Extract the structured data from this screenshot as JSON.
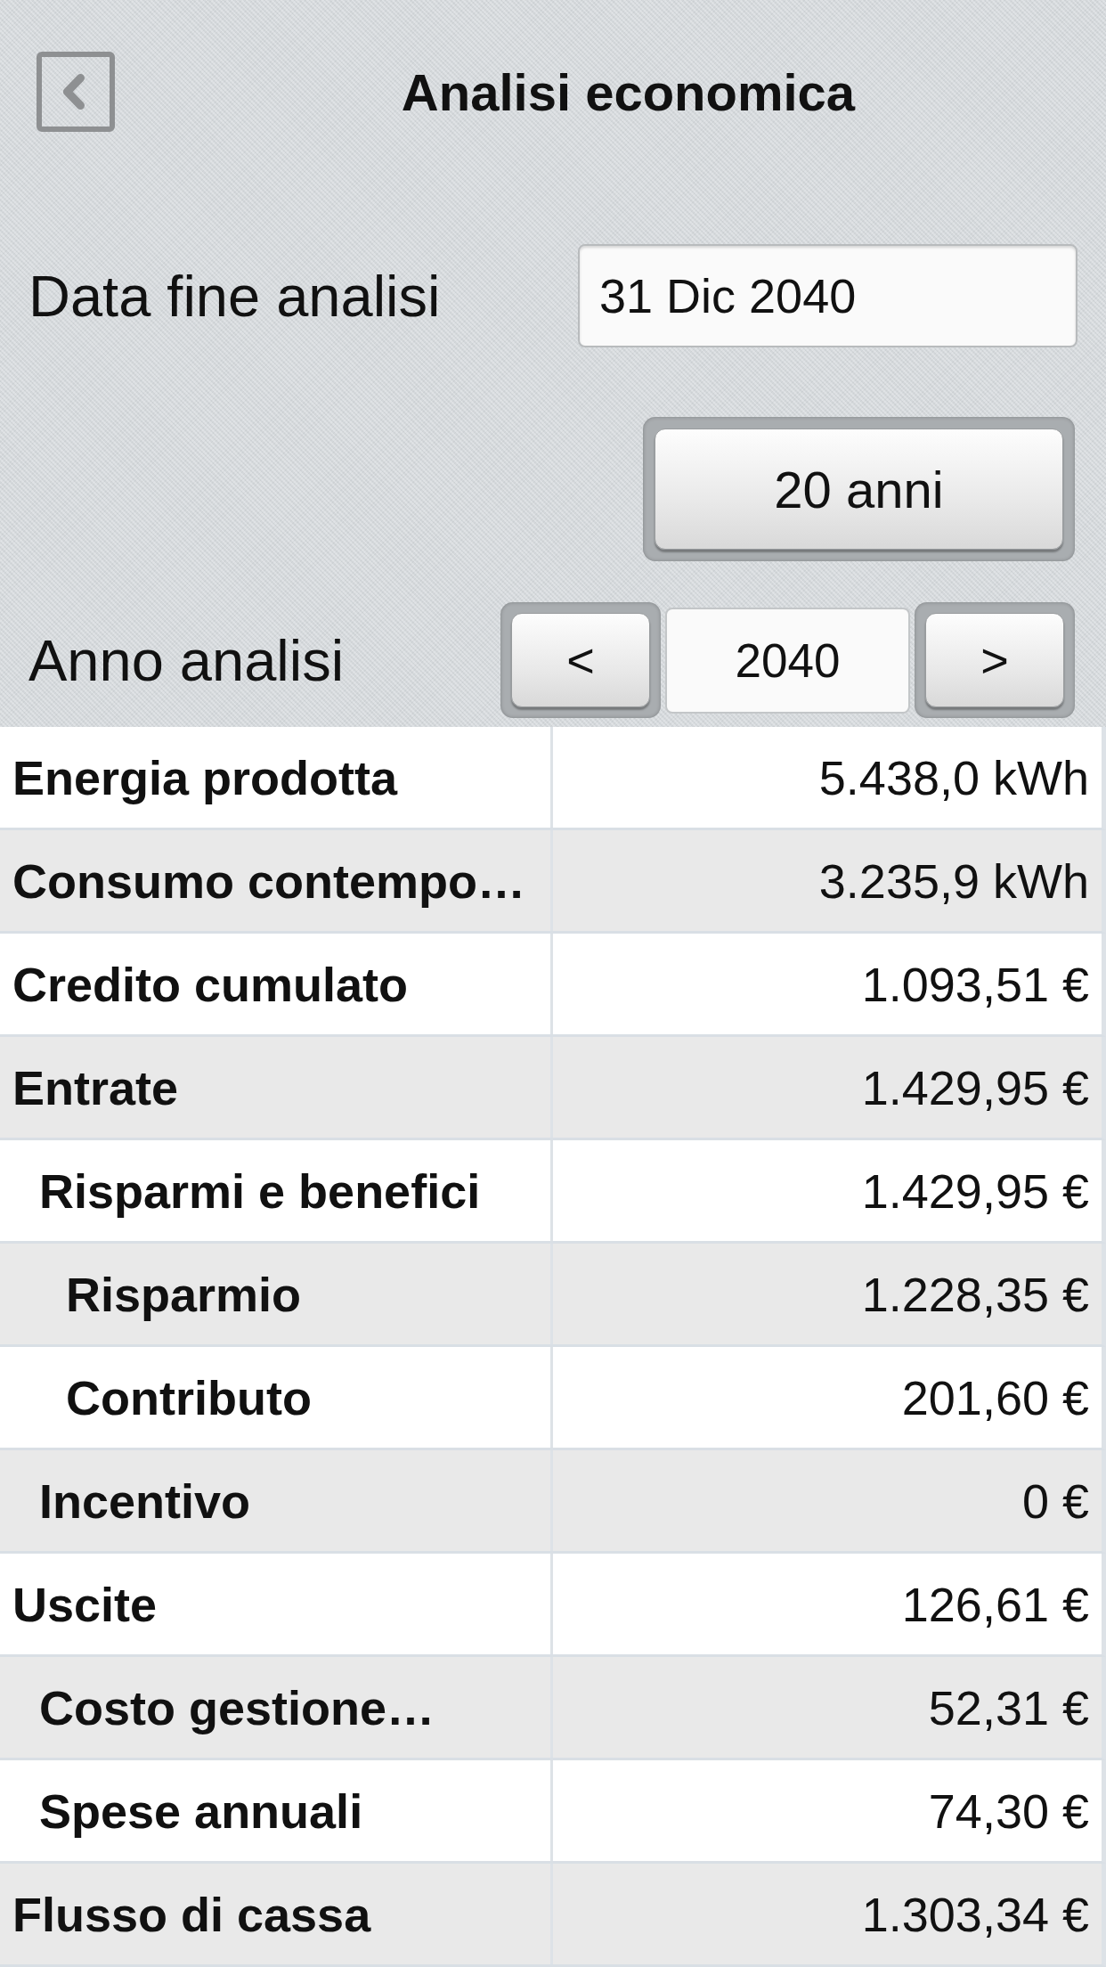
{
  "header": {
    "title": "Analisi economica"
  },
  "end_date": {
    "label": "Data fine analisi",
    "value": "31 Dic 2040"
  },
  "duration_button": {
    "label": "20 anni"
  },
  "year": {
    "label": "Anno analisi",
    "prev": "<",
    "value": "2040",
    "next": ">"
  },
  "table": {
    "rows": [
      {
        "label": "Energia prodotta",
        "value": "5.438,0 kWh"
      },
      {
        "label": "Consumo contempo…",
        "value": "3.235,9 kWh"
      },
      {
        "label": "Credito cumulato",
        "value": "1.093,51 €"
      },
      {
        "label": "Entrate",
        "value": "1.429,95 €",
        "children": [
          {
            "label": "Risparmi e benefici",
            "value": "1.429,95 €",
            "children": [
              {
                "label": "Risparmio",
                "value": "1.228,35 €"
              },
              {
                "label": "Contributo",
                "value": "201,60 €"
              }
            ]
          },
          {
            "label": "Incentivo",
            "value": "0 €"
          }
        ]
      },
      {
        "label": "Uscite",
        "value": "126,61 €",
        "children": [
          {
            "label": "Costo gestione…",
            "value": "52,31 €"
          },
          {
            "label": "Spese annuali",
            "value": "74,30 €"
          }
        ]
      },
      {
        "label": "Flusso di cassa",
        "value": "1.303,34 €"
      }
    ]
  }
}
